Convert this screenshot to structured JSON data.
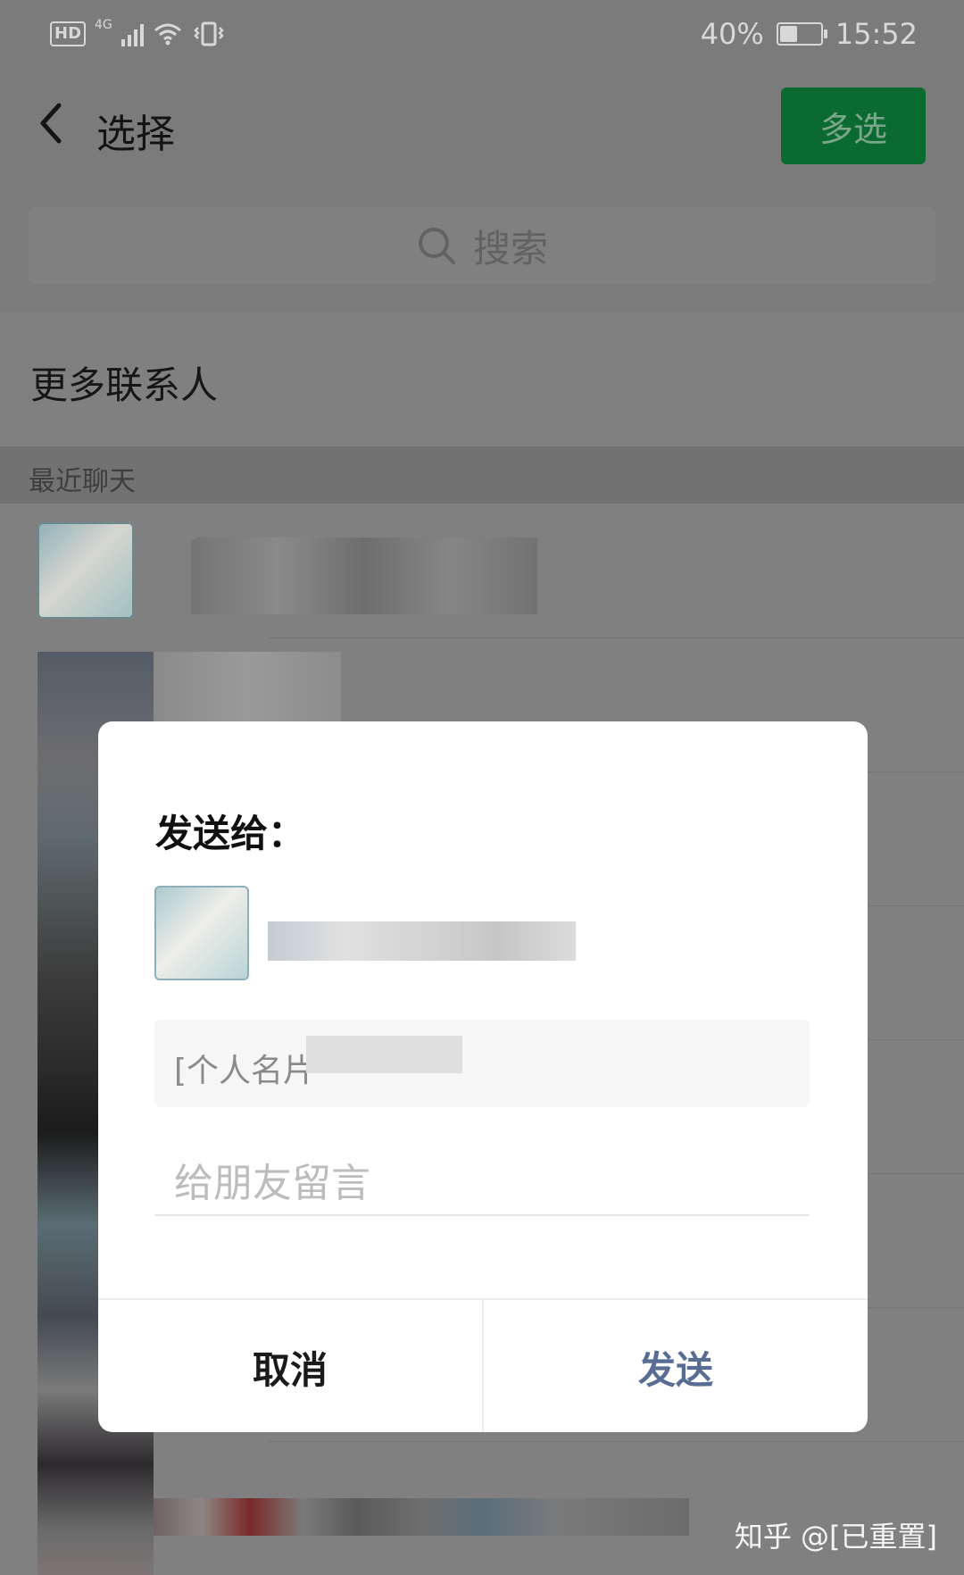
{
  "status_bar": {
    "hd": "HD",
    "network": "4G",
    "battery": "40%",
    "battery_level": 0.4,
    "time": "15:52"
  },
  "header": {
    "title": "选择",
    "multi_select_label": "多选"
  },
  "search": {
    "placeholder": "搜索"
  },
  "more_contacts": {
    "label": "更多联系人"
  },
  "recent_section": {
    "label": "最近聊天"
  },
  "dialog": {
    "title": "发送给：",
    "card_preview": "[个人名片",
    "message_placeholder": "给朋友留言",
    "cancel_label": "取消",
    "send_label": "发送"
  },
  "watermark": "知乎 @[已重置]",
  "colors": {
    "wechat_green": "#0a6a2f",
    "send_blue": "#586c94"
  }
}
